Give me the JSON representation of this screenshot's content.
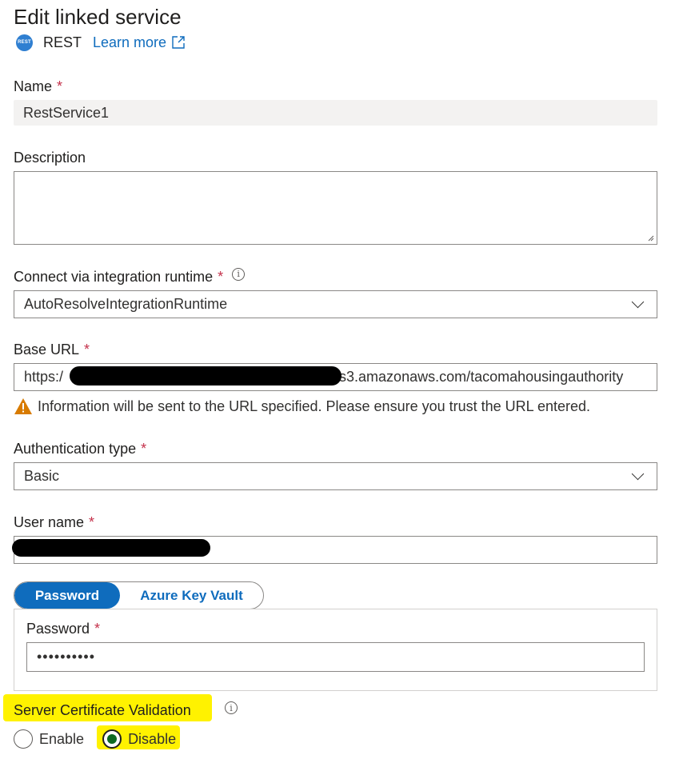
{
  "header": {
    "title": "Edit linked service",
    "connector_icon": "REST",
    "connector_label": "REST",
    "learn_more": "Learn more"
  },
  "name": {
    "label": "Name",
    "required": "*",
    "value": "RestService1"
  },
  "description": {
    "label": "Description",
    "value": ""
  },
  "runtime": {
    "label": "Connect via integration runtime",
    "required": "*",
    "value": "AutoResolveIntegrationRuntime"
  },
  "base_url": {
    "label": "Base URL",
    "required": "*",
    "value_prefix": "https:/",
    "value_suffix": ".s3.amazonaws.com/tacomahousingauthority",
    "warning": "Information will be sent to the URL specified. Please ensure you trust the URL entered."
  },
  "auth": {
    "label": "Authentication type",
    "required": "*",
    "value": "Basic"
  },
  "username": {
    "label": "User name",
    "required": "*"
  },
  "password_toggle": {
    "option_password": "Password",
    "option_keyvault": "Azure Key Vault"
  },
  "password": {
    "label": "Password",
    "required": "*",
    "value": "••••••••••"
  },
  "cert_validation": {
    "label": "Server Certificate Validation",
    "enable": "Enable",
    "disable": "Disable",
    "selected": "Disable"
  },
  "colors": {
    "accent": "#0f6cbd",
    "required": "#c4314b",
    "highlight": "#fff200",
    "warning": "#d87b00"
  }
}
